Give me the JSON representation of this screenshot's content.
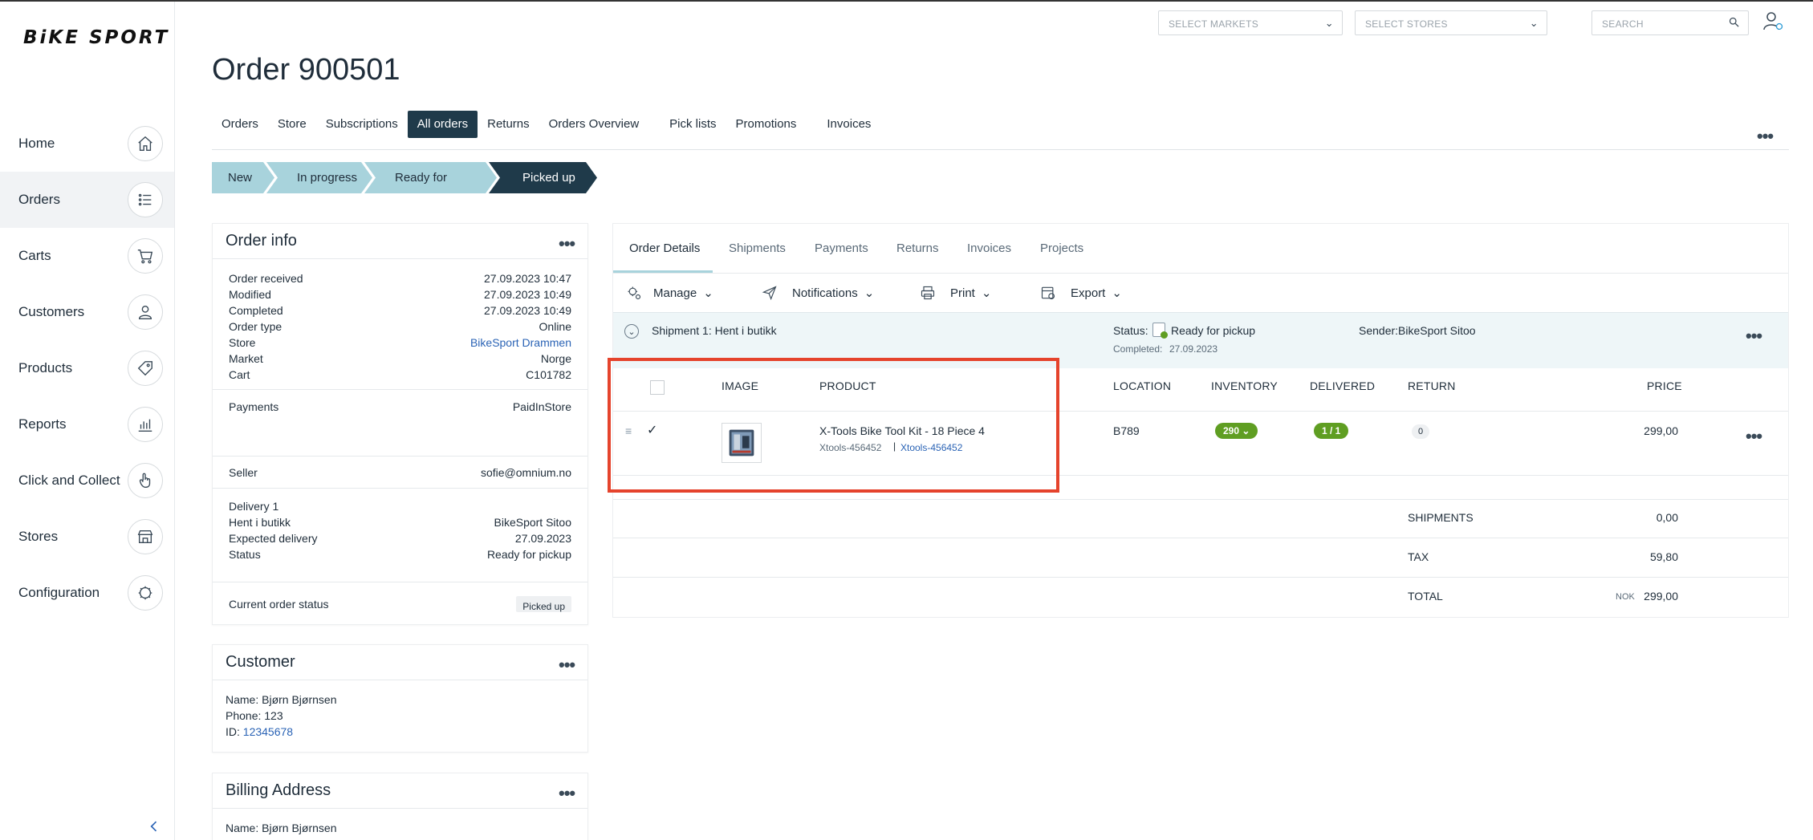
{
  "app": {
    "logo": "BiKE SPORT"
  },
  "sidebar": {
    "items": [
      {
        "label": "Home",
        "icon": "home-icon"
      },
      {
        "label": "Orders",
        "icon": "list-icon",
        "active": true
      },
      {
        "label": "Carts",
        "icon": "cart-icon"
      },
      {
        "label": "Customers",
        "icon": "user-icon"
      },
      {
        "label": "Products",
        "icon": "tag-icon"
      },
      {
        "label": "Reports",
        "icon": "bar-chart-icon"
      },
      {
        "label": "Click and Collect",
        "icon": "hand-pointer-icon"
      },
      {
        "label": "Stores",
        "icon": "store-icon"
      },
      {
        "label": "Configuration",
        "icon": "gear-icon"
      }
    ]
  },
  "topbar": {
    "markets_placeholder": "SELECT MARKETS",
    "stores_placeholder": "SELECT STORES",
    "search_placeholder": "SEARCH"
  },
  "page": {
    "title": "Order 900501",
    "tabs": [
      "Orders",
      "Store",
      "Subscriptions",
      "All orders",
      "Returns",
      "Orders Overview",
      "Pick lists",
      "Promotions",
      "Invoices"
    ],
    "active_tab": "All orders",
    "steps": [
      "New",
      "In progress",
      "Ready for pickup",
      "Picked up"
    ]
  },
  "order_info": {
    "title": "Order info",
    "received_label": "Order received",
    "received": "27.09.2023 10:47",
    "modified_label": "Modified",
    "modified": "27.09.2023 10:49",
    "completed_label": "Completed",
    "completed": "27.09.2023 10:49",
    "type_label": "Order type",
    "type": "Online",
    "store_label": "Store",
    "store": "BikeSport Drammen",
    "market_label": "Market",
    "market": "Norge",
    "cart_label": "Cart",
    "cart": "C101782",
    "payments_label": "Payments",
    "payments": "PaidInStore",
    "seller_label": "Seller",
    "seller": "sofie@omnium.no",
    "delivery_label": "Delivery 1",
    "delivery_method_label": "Hent i butikk",
    "delivery_method": "BikeSport Sitoo",
    "expected_label": "Expected delivery",
    "expected": "27.09.2023",
    "status_label": "Status",
    "status": "Ready for pickup",
    "current_status_label": "Current order status",
    "current_status": "Picked up"
  },
  "customer": {
    "title": "Customer",
    "name": "Name: Bjørn Bjørnsen",
    "phone": "Phone: 123",
    "id_label": "ID:",
    "id": "12345678"
  },
  "billing": {
    "title": "Billing Address",
    "name": "Name: Bjørn Bjørnsen"
  },
  "details": {
    "tabs": [
      "Order Details",
      "Shipments",
      "Payments",
      "Returns",
      "Invoices",
      "Projects"
    ],
    "toolbar": [
      "Manage",
      "Notifications",
      "Print",
      "Export"
    ],
    "shipment_title": "Shipment 1: Hent i butikk",
    "status_label": "Status:",
    "status_value": "Ready for pickup",
    "completed_label": "Completed:",
    "completed_value": "27.09.2023",
    "sender": "Sender:BikeSport Sitoo",
    "columns": [
      "IMAGE",
      "PRODUCT",
      "LOCATION",
      "INVENTORY",
      "DELIVERED",
      "RETURN",
      "PRICE"
    ],
    "line": {
      "name": "X-Tools Bike Tool Kit - 18 Piece 4",
      "sku": "Xtools-456452",
      "sku_link": "Xtools-456452",
      "location": "B789",
      "inventory": "290",
      "delivered": "1 / 1",
      "return": "0",
      "price": "299,00"
    },
    "summary": {
      "shipments_label": "SHIPMENTS",
      "shipments": "0,00",
      "tax_label": "TAX",
      "tax": "59,80",
      "total_label": "TOTAL",
      "currency": "NOK",
      "total": "299,00"
    }
  },
  "colors": {
    "accent": "#1f3a4a",
    "step": "#a8d3dc",
    "link": "#2a63b5",
    "green": "#5f9e22",
    "highlight": "#e5432c"
  }
}
